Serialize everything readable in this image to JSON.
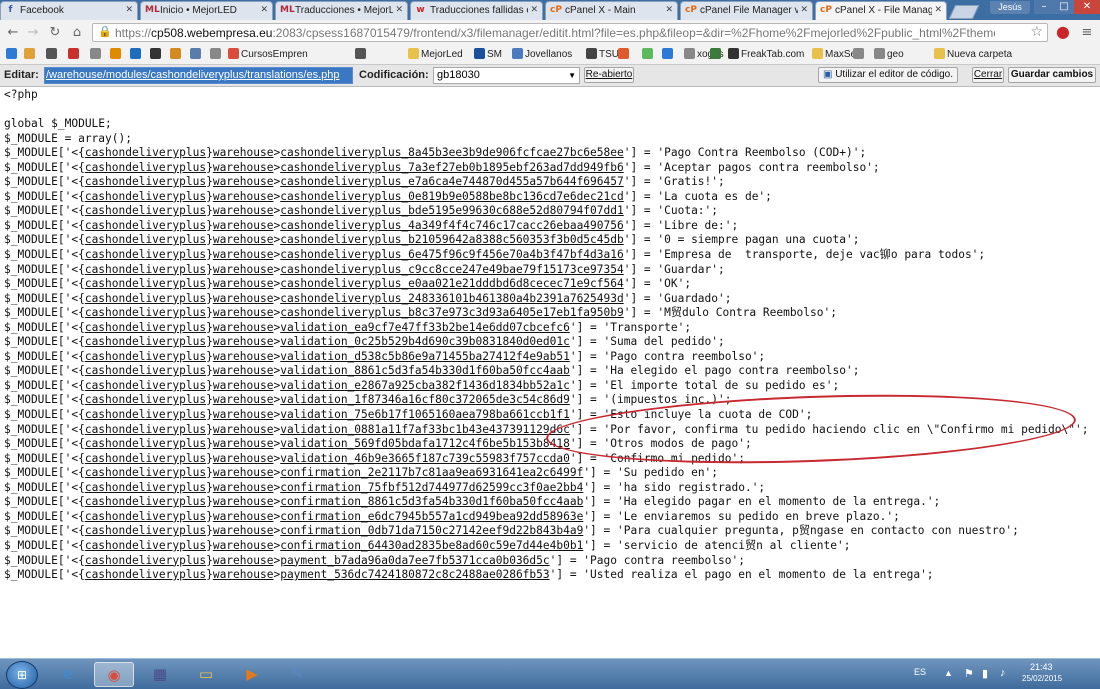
{
  "browser": {
    "tabs": [
      {
        "title": "Facebook",
        "icon": "facebook-icon",
        "icon_glyph": "f",
        "icon_color": "#3b5998"
      },
      {
        "title": "Inicio • MejorLED",
        "icon": "mejorled-icon",
        "icon_glyph": "ML",
        "icon_color": "#b0283a"
      },
      {
        "title": "Traducciones • MejorL",
        "icon": "mejorled-icon",
        "icon_glyph": "ML",
        "icon_color": "#b0283a"
      },
      {
        "title": "Traducciones fallidas e",
        "icon": "prestashop-icon",
        "icon_glyph": "w",
        "icon_color": "#cc2222"
      },
      {
        "title": "cPanel X - Main",
        "icon": "cpanel-icon",
        "icon_glyph": "cP",
        "icon_color": "#e36a10"
      },
      {
        "title": "cPanel File Manager v3",
        "icon": "cpanel-icon",
        "icon_glyph": "cP",
        "icon_color": "#e36a10"
      },
      {
        "title": "cPanel X - File Manag",
        "icon": "cpanel-icon",
        "icon_glyph": "cP",
        "icon_color": "#e36a10"
      }
    ],
    "user": "Jesús",
    "url_scheme": "https://",
    "url_host": "cp508.webempresa.eu",
    "url_rest": ":2083/cpsess1687015479/frontend/x3/filemanager/editit.html?file=es.php&fileop=&dir=%2Fhome%2Fmejorled%2Fpublic_html%2Fthemes%..."
  },
  "bookmarks": [
    {
      "label": "",
      "icon": "bookmark-icon",
      "color": "#2e7bd6"
    },
    {
      "label": "",
      "icon": "bookmark-icon",
      "color": "#e0a13a"
    },
    {
      "label": "",
      "icon": "bookmark-icon",
      "color": "#555555"
    },
    {
      "label": "",
      "icon": "bookmark-icon",
      "color": "#c9302c"
    },
    {
      "label": "",
      "icon": "bookmark-icon",
      "color": "#888888"
    },
    {
      "label": "",
      "icon": "bookmark-icon",
      "color": "#e08a00"
    },
    {
      "label": "",
      "icon": "bookmark-icon",
      "color": "#1d6dbf"
    },
    {
      "label": "",
      "icon": "bookmark-icon",
      "color": "#333333"
    },
    {
      "label": "",
      "icon": "bookmark-icon",
      "color": "#d48a1e"
    },
    {
      "label": "",
      "icon": "bookmark-icon",
      "color": "#5a7ca8"
    },
    {
      "label": "",
      "icon": "bookmark-icon",
      "color": "#888888"
    },
    {
      "label": "CursosEmpren",
      "icon": "bookmark-icon",
      "color": "#d94b3b"
    },
    {
      "label": "",
      "icon": "bookmark-icon",
      "color": "#555555"
    },
    {
      "label": "MejorLed",
      "icon": "folder-icon",
      "color": "#e8c14a"
    },
    {
      "label": "SM",
      "icon": "bookmark-icon",
      "color": "#1b4f9c"
    },
    {
      "label": "Jovellanos",
      "icon": "bookmark-icon",
      "color": "#4a7abf"
    },
    {
      "label": "TSUB",
      "icon": "bookmark-icon",
      "color": "#444444"
    },
    {
      "label": "",
      "icon": "bookmark-icon",
      "color": "#e05a2b"
    },
    {
      "label": "",
      "icon": "bookmark-icon",
      "color": "#5cb85c"
    },
    {
      "label": "",
      "icon": "bookmark-icon",
      "color": "#2b7bd6"
    },
    {
      "label": "xogos",
      "icon": "bookmark-icon",
      "color": "#888888"
    },
    {
      "label": "",
      "icon": "bookmark-icon",
      "color": "#3a7a3a"
    },
    {
      "label": "FreakTab.com",
      "icon": "bookmark-icon",
      "color": "#333333"
    },
    {
      "label": "MaxSea",
      "icon": "folder-icon",
      "color": "#e8c14a"
    },
    {
      "label": "",
      "icon": "bookmark-icon",
      "color": "#888888"
    },
    {
      "label": "geo",
      "icon": "bookmark-icon",
      "color": "#888888"
    },
    {
      "label": "Nueva carpeta",
      "icon": "folder-icon",
      "color": "#e8c14a"
    }
  ],
  "editor": {
    "edit_label": "Editar:",
    "file_path": "/warehouse/modules/cashondeliveryplus/translations/es.php",
    "encoding_label": "Codificación:",
    "encoding_value": "gb18030",
    "reopen_button": "Re-abierto",
    "code_editor_button": "Utilizar el editor de código.",
    "close_button": "Cerrar",
    "save_button": "Guardar cambios"
  },
  "code_lines": [
    "<?php",
    "",
    "global $_MODULE;",
    "$_MODULE = array();",
    "$_MODULE['<{cashondeliveryplus}warehouse>cashondeliveryplus_8a45b3ee3b9de906fcfcae27bc6e58ee'] = 'Pago Contra Reembolso (COD+)';",
    "$_MODULE['<{cashondeliveryplus}warehouse>cashondeliveryplus_7a3ef27eb0b1895ebf263ad7dd949fb6'] = 'Aceptar pagos contra reembolso';",
    "$_MODULE['<{cashondeliveryplus}warehouse>cashondeliveryplus_e7a6ca4e744870d455a57b644f696457'] = 'Gratis!';",
    "$_MODULE['<{cashondeliveryplus}warehouse>cashondeliveryplus_0e819b9e0588be8bc136cd7e6dec21cd'] = 'La cuota es de';",
    "$_MODULE['<{cashondeliveryplus}warehouse>cashondeliveryplus_bde5195e99630c688e52d80794f07dd1'] = 'Cuota:';",
    "$_MODULE['<{cashondeliveryplus}warehouse>cashondeliveryplus_4a349f4f4c746c17cacc26ebaa490756'] = 'Libre de:';",
    "$_MODULE['<{cashondeliveryplus}warehouse>cashondeliveryplus_b21059642a8388c560353f3b0d5c45db'] = '0 = siempre pagan una cuota';",
    "$_MODULE['<{cashondeliveryplus}warehouse>cashondeliveryplus_6e475f96c9f456e70a4b3f47bf4d3a16'] = 'Empresa de  transporte, deje vac铆o para todos';",
    "$_MODULE['<{cashondeliveryplus}warehouse>cashondeliveryplus_c9cc8cce247e49bae79f15173ce97354'] = 'Guardar';",
    "$_MODULE['<{cashondeliveryplus}warehouse>cashondeliveryplus_e0aa021e21dddbd6d8cecec71e9cf564'] = 'OK';",
    "$_MODULE['<{cashondeliveryplus}warehouse>cashondeliveryplus_248336101b461380a4b2391a7625493d'] = 'Guardado';",
    "$_MODULE['<{cashondeliveryplus}warehouse>cashondeliveryplus_b8c37e973c3d93a6405e17eb1fa950b9'] = 'M贸dulo Contra Reembolso';",
    "$_MODULE['<{cashondeliveryplus}warehouse>validation_ea9cf7e47ff33b2be14e6dd07cbcefc6'] = 'Transporte';",
    "$_MODULE['<{cashondeliveryplus}warehouse>validation_0c25b529b4d690c39b0831840d0ed01c'] = 'Suma del pedido';",
    "$_MODULE['<{cashondeliveryplus}warehouse>validation_d538c5b86e9a71455ba27412f4e9ab51'] = 'Pago contra reembolso';",
    "$_MODULE['<{cashondeliveryplus}warehouse>validation_8861c5d3fa54b330d1f60ba50fcc4aab'] = 'Ha elegido el pago contra reembolso';",
    "$_MODULE['<{cashondeliveryplus}warehouse>validation_e2867a925cba382f1436d1834bb52a1c'] = 'El importe total de su pedido es';",
    "$_MODULE['<{cashondeliveryplus}warehouse>validation_1f87346a16cf80c372065de3c54c86d9'] = '(impuestos inc.)';",
    "$_MODULE['<{cashondeliveryplus}warehouse>validation_75e6b17f1065160aea798ba661ccb1f1'] = 'Esto incluye la cuota de COD';",
    "$_MODULE['<{cashondeliveryplus}warehouse>validation_0881a11f7af33bc1b43e437391129d6c'] = 'Por favor, confirma tu pedido haciendo clic en \\\"Confirmo mi pedido\\\"';",
    "$_MODULE['<{cashondeliveryplus}warehouse>validation_569fd05bdafa1712c4f6be5b153b8418'] = 'Otros modos de pago';",
    "$_MODULE['<{cashondeliveryplus}warehouse>validation_46b9e3665f187c739c55983f757ccda0'] = 'Confirmo mi pedido';",
    "$_MODULE['<{cashondeliveryplus}warehouse>confirmation_2e2117b7c81aa9ea6931641ea2c6499f'] = 'Su pedido en';",
    "$_MODULE['<{cashondeliveryplus}warehouse>confirmation_75fbf512d744977d62599cc3f0ae2bb4'] = 'ha sido registrado.';",
    "$_MODULE['<{cashondeliveryplus}warehouse>confirmation_8861c5d3fa54b330d1f60ba50fcc4aab'] = 'Ha elegido pagar en el momento de la entrega.';",
    "$_MODULE['<{cashondeliveryplus}warehouse>confirmation_e6dc7945b557a1cd949bea92dd58963e'] = 'Le enviaremos su pedido en breve plazo.';",
    "$_MODULE['<{cashondeliveryplus}warehouse>confirmation_0db71da7150c27142eef9d22b843b4a9'] = 'Para cualquier pregunta, p贸ngase en contacto con nuestro';",
    "$_MODULE['<{cashondeliveryplus}warehouse>confirmation_64430ad2835be8ad60c59e7d44e4b0b1'] = 'servicio de atenci贸n al cliente';",
    "$_MODULE['<{cashondeliveryplus}warehouse>payment_b7ada96a0da7ee7fb5371cca0b036d5c'] = 'Pago contra reembolso';",
    "$_MODULE['<{cashondeliveryplus}warehouse>payment_536dc7424180872c8c2488ae0286fb53'] = 'Usted realiza el pago en el momento de la entrega';"
  ],
  "taskbar": {
    "apps": [
      {
        "name": "internet-explorer-icon",
        "glyph": "e",
        "color": "#3a8fd8"
      },
      {
        "name": "chrome-icon",
        "glyph": "◉",
        "color": "#d94b3b"
      },
      {
        "name": "metro-apps-icon",
        "glyph": "▦",
        "color": "#4a4a8a"
      },
      {
        "name": "file-explorer-icon",
        "glyph": "▭",
        "color": "#e8c14a"
      },
      {
        "name": "media-player-icon",
        "glyph": "▶",
        "color": "#e07a1a"
      },
      {
        "name": "paint-icon",
        "glyph": "✎",
        "color": "#5a8abf"
      }
    ],
    "language": "ES",
    "time": "21:43",
    "date": "25/02/2015"
  }
}
